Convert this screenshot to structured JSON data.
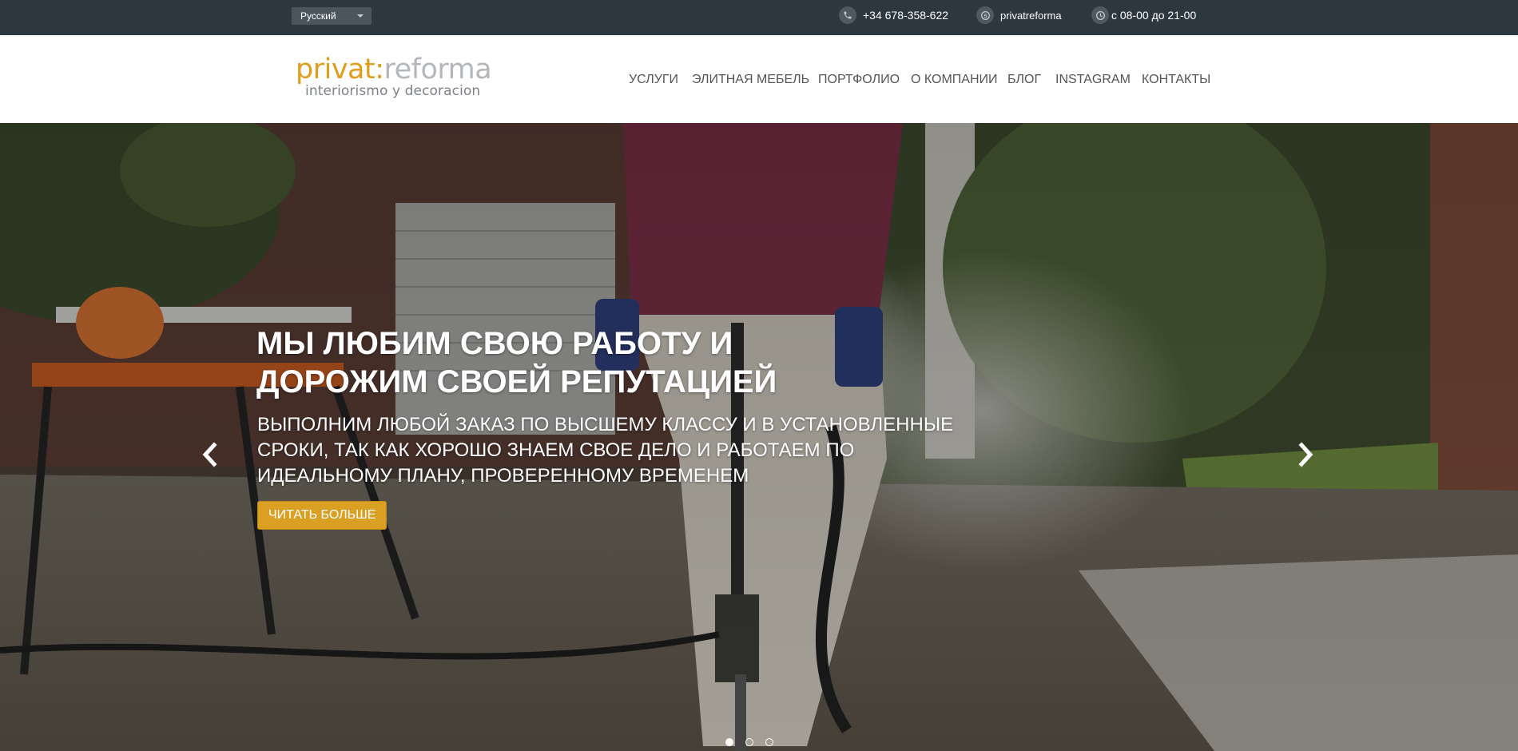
{
  "topbar": {
    "language": "Русский",
    "phone": "+34 678-358-622",
    "skype": "privatreforma",
    "hours": "с 08-00 до 21-00",
    "icons": {
      "phone": "phone-icon",
      "skype": "skype-icon",
      "hours": "clock-icon"
    }
  },
  "header": {
    "logo": {
      "main_left": "privat:",
      "main_right": "reforma",
      "tagline": "interiorismo y decoracion"
    },
    "nav": [
      {
        "label": "УСЛУГИ"
      },
      {
        "label": "ЭЛИТНАЯ МЕБЕЛЬ"
      },
      {
        "label": "ПОРТФОЛИО"
      },
      {
        "label": "О КОМПАНИИ"
      },
      {
        "label": "БЛОГ"
      },
      {
        "label": "INSTAGRAM"
      },
      {
        "label": "КОНТАКТЫ"
      }
    ]
  },
  "hero": {
    "title": "МЫ ЛЮБИМ СВОЮ РАБОТУ И ДОРОЖИМ СВОЕЙ РЕПУТАЦИЕЙ",
    "text": "ВЫПОЛНИМ ЛЮБОЙ ЗАКАЗ ПО ВЫСШЕМУ КЛАССУ И В УСТАНОВЛЕННЫЕ СРОКИ, ТАК КАК ХОРОШО ЗНАЕМ СВОЕ ДЕЛО И РАБОТАЕМ ПО ИДЕАЛЬНОМУ ПЛАНУ, ПРОВЕРЕННОМУ ВРЕМЕНЕМ",
    "button": "ЧИТАТЬ БОЛЬШЕ",
    "slides_total": 3,
    "active_slide": 1
  },
  "colors": {
    "topbar_bg": "#2c3740",
    "accent": "#daa023",
    "logo_orange": "#e09d1d",
    "nav_text": "#555555"
  }
}
